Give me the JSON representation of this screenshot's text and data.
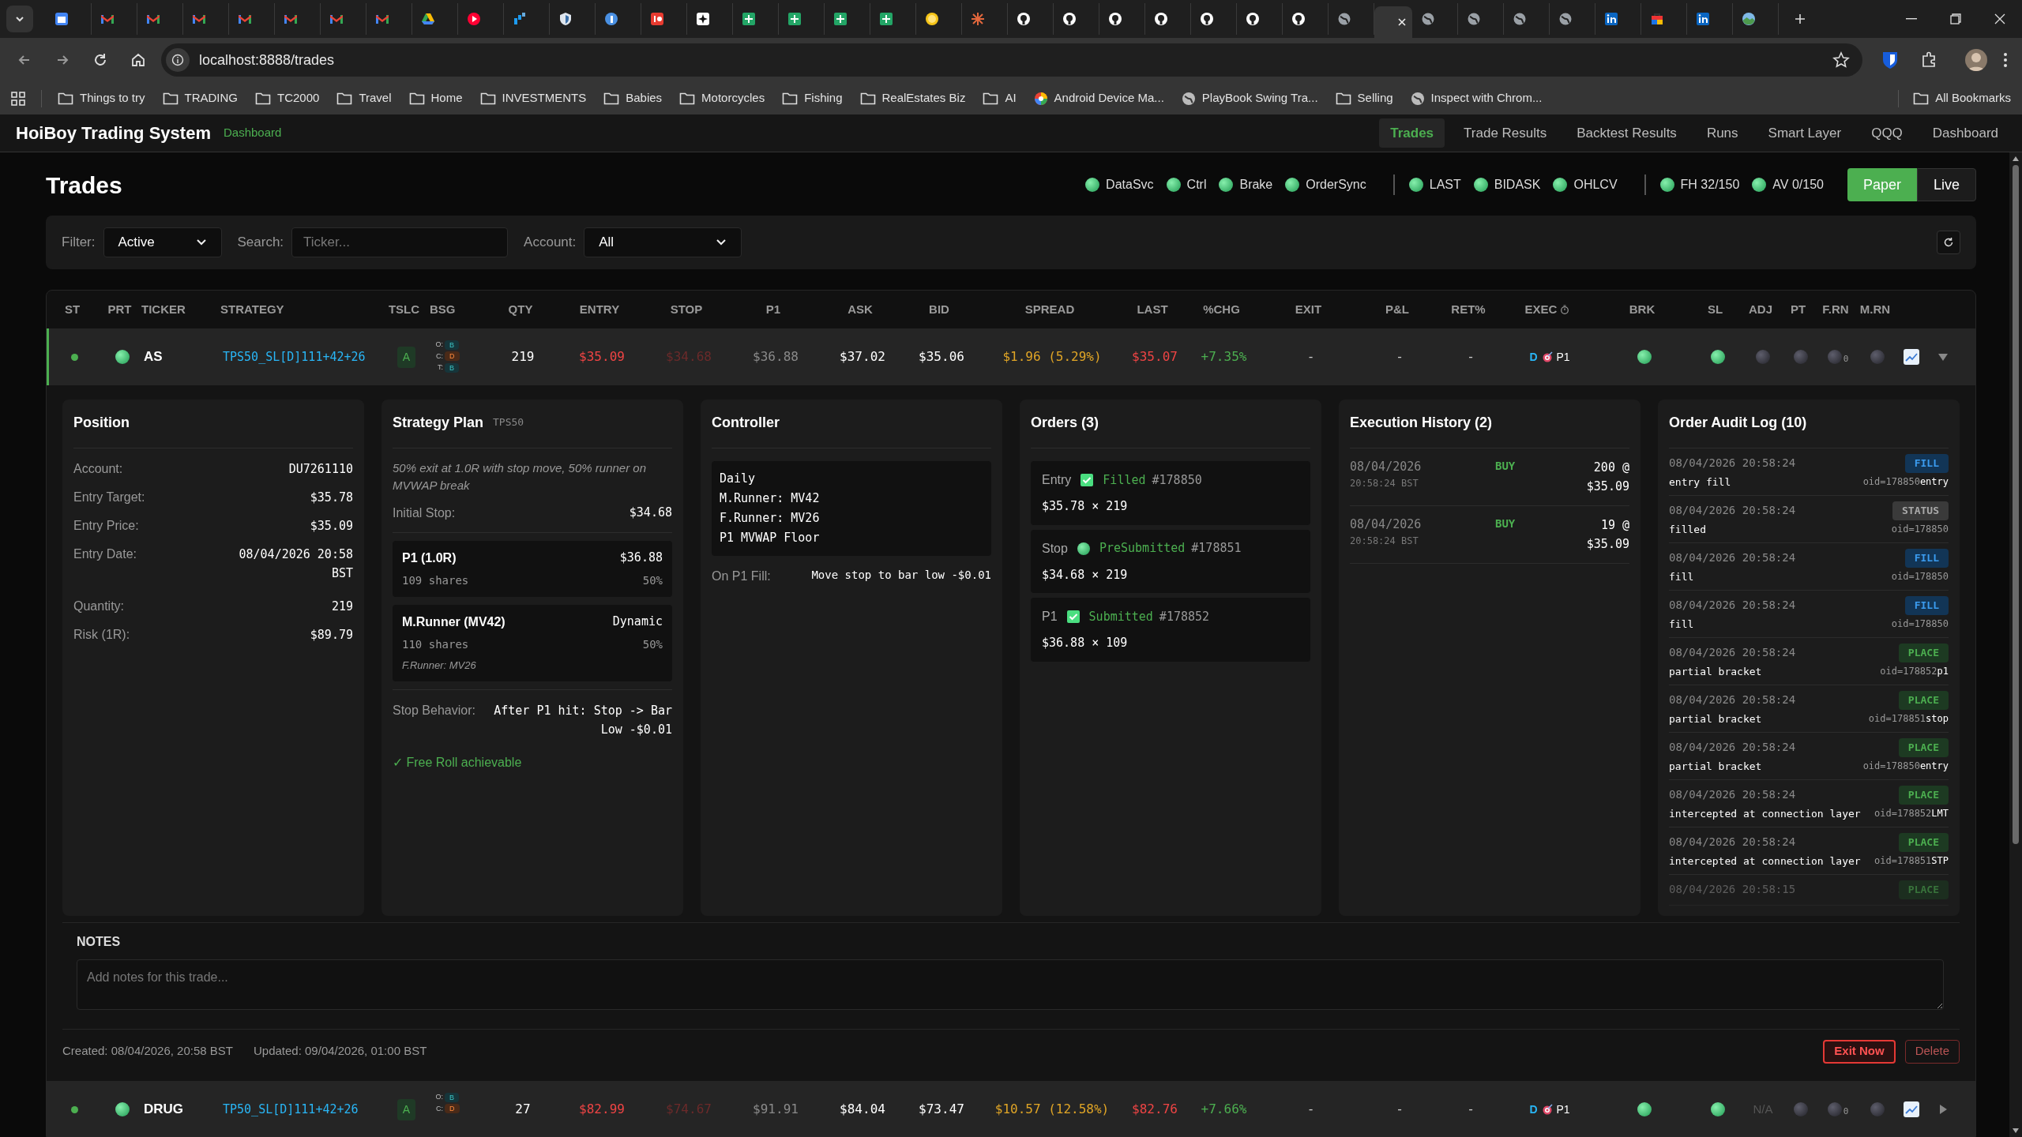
{
  "browser": {
    "tabs": [
      {
        "kind": "calendar",
        "selected": false
      },
      {
        "kind": "mail",
        "selected": false
      },
      {
        "kind": "mail",
        "selected": false
      },
      {
        "kind": "mail",
        "selected": false
      },
      {
        "kind": "mail",
        "selected": false
      },
      {
        "kind": "mail",
        "selected": false
      },
      {
        "kind": "mail",
        "selected": false
      },
      {
        "kind": "mail",
        "selected": false
      },
      {
        "kind": "drive",
        "selected": false
      },
      {
        "kind": "play",
        "selected": false
      },
      {
        "kind": "bars",
        "selected": false
      },
      {
        "kind": "shield",
        "selected": false
      },
      {
        "kind": "bluecircle",
        "selected": false
      },
      {
        "kind": "redsquare",
        "selected": false
      },
      {
        "kind": "sparkle",
        "selected": false
      },
      {
        "kind": "sheets",
        "selected": false
      },
      {
        "kind": "sheets",
        "selected": false
      },
      {
        "kind": "sheets",
        "selected": false
      },
      {
        "kind": "sheets",
        "selected": false
      },
      {
        "kind": "bulb",
        "selected": false
      },
      {
        "kind": "starburst",
        "selected": false
      },
      {
        "kind": "github",
        "selected": false
      },
      {
        "kind": "github",
        "selected": false
      },
      {
        "kind": "github",
        "selected": false
      },
      {
        "kind": "github",
        "selected": false
      },
      {
        "kind": "github",
        "selected": false
      },
      {
        "kind": "github",
        "selected": false
      },
      {
        "kind": "github",
        "selected": false
      },
      {
        "kind": "globe",
        "selected": false
      },
      {
        "kind": "blank",
        "selected": true
      },
      {
        "kind": "globe",
        "selected": false
      },
      {
        "kind": "globe",
        "selected": false
      },
      {
        "kind": "globe",
        "selected": false
      },
      {
        "kind": "globe",
        "selected": false
      },
      {
        "kind": "linkedin",
        "selected": false
      },
      {
        "kind": "bag",
        "selected": false
      },
      {
        "kind": "linkedin",
        "selected": false
      },
      {
        "kind": "landscape",
        "selected": false
      }
    ],
    "url": "localhost:8888/trades",
    "bookmarks": [
      {
        "kind": "folder",
        "label": "Things to try"
      },
      {
        "kind": "folder",
        "label": "TRADING"
      },
      {
        "kind": "folder",
        "label": "TC2000"
      },
      {
        "kind": "folder",
        "label": "Travel"
      },
      {
        "kind": "folder",
        "label": "Home"
      },
      {
        "kind": "folder",
        "label": "INVESTMENTS"
      },
      {
        "kind": "folder",
        "label": "Babies"
      },
      {
        "kind": "folder",
        "label": "Motorcycles"
      },
      {
        "kind": "folder",
        "label": "Fishing"
      },
      {
        "kind": "folder",
        "label": "RealEstates Biz"
      },
      {
        "kind": "folder",
        "label": "AI"
      },
      {
        "kind": "site",
        "label": "Android Device Ma..."
      },
      {
        "kind": "globe",
        "label": "PlayBook Swing Tra..."
      },
      {
        "kind": "folder",
        "label": "Selling"
      },
      {
        "kind": "globe",
        "label": "Inspect with Chrom..."
      }
    ],
    "all_bookmarks": "All Bookmarks"
  },
  "app": {
    "title": "HoiBoy Trading System",
    "subtitle": "Dashboard",
    "nav": [
      {
        "label": "Trades",
        "selected": true
      },
      {
        "label": "Trade Results",
        "selected": false
      },
      {
        "label": "Backtest Results",
        "selected": false
      },
      {
        "label": "Runs",
        "selected": false
      },
      {
        "label": "Smart Layer",
        "selected": false
      },
      {
        "label": "QQQ",
        "selected": false
      },
      {
        "label": "Dashboard",
        "selected": false
      }
    ]
  },
  "page_title": "Trades",
  "indicators": [
    [
      {
        "label": "DataSvc",
        "on": true
      },
      {
        "label": "Ctrl",
        "on": true
      },
      {
        "label": "Brake",
        "on": true
      },
      {
        "label": "OrderSync",
        "on": true
      }
    ],
    [
      {
        "label": "LAST",
        "on": true
      },
      {
        "label": "BIDASK",
        "on": true
      },
      {
        "label": "OHLCV",
        "on": true
      }
    ],
    [
      {
        "label": "FH 32/150",
        "on": true
      },
      {
        "label": "AV 0/150",
        "on": true
      }
    ]
  ],
  "modes": [
    {
      "label": "Paper",
      "selected": true
    },
    {
      "label": "Live",
      "selected": false
    }
  ],
  "filters": {
    "filter_label": "Filter:",
    "filter_value": "Active",
    "search_label": "Search:",
    "search_placeholder": "Ticker...",
    "account_label": "Account:",
    "account_value": "All"
  },
  "table": {
    "columns": [
      "ST",
      "PRT",
      "TICKER",
      "STRATEGY",
      "TSLC",
      "BSG",
      "QTY",
      "ENTRY",
      "STOP",
      "P1",
      "ASK",
      "BID",
      "SPREAD",
      "LAST",
      "%CHG",
      "EXIT",
      "P&L",
      "RET%",
      "EXEC",
      "BRK",
      "SL",
      "ADJ",
      "PT",
      "F.RN",
      "M.RN"
    ],
    "rows": [
      {
        "st": true,
        "prt": true,
        "ticker": "AS",
        "strategy": "TPS50_SL[D]111+42+26",
        "tslc": "A",
        "bsg": [
          {
            "label": "O:",
            "value": "B",
            "kind": "b"
          },
          {
            "label": "C:",
            "value": "D",
            "kind": "d"
          },
          {
            "label": "T:",
            "value": "B",
            "kind": "b"
          }
        ],
        "qty": "219",
        "entry": "$35.09",
        "stop": "$34.68",
        "p1": "$36.88",
        "ask": "$37.02",
        "bid": "$35.06",
        "spread": "$1.96 (5.29%)",
        "last": "$35.07",
        "chg": "+7.35%",
        "exit": "-",
        "pnl": "-",
        "ret": "-",
        "exec_mode": "D",
        "exec_target": "P1",
        "brk": true,
        "sl": true,
        "adj": {
          "kind": "light",
          "on": false
        },
        "pt": false,
        "frn": {
          "on": false,
          "count": "0"
        },
        "mrn": false,
        "expanded": true,
        "detail": {
          "position": {
            "title": "Position",
            "rows": [
              {
                "label": "Account:",
                "value": "DU7261110"
              },
              {
                "label": "Entry Target:",
                "value": "$35.78"
              },
              {
                "label": "Entry Price:",
                "value": "$35.09"
              },
              {
                "label": "Entry Date:",
                "value": "08/04/2026 20:58 BST"
              },
              {
                "label": "Quantity:",
                "value": "219"
              },
              {
                "label": "Risk (1R):",
                "value": "$89.79"
              }
            ]
          },
          "plan": {
            "title": "Strategy Plan",
            "tag": "TPS50",
            "description": "50% exit at 1.0R with stop move, 50% runner on MVWAP break",
            "initial_stop_label": "Initial Stop:",
            "initial_stop": "$34.68",
            "targets": [
              {
                "name": "P1 (1.0R)",
                "value": "$36.88",
                "shares": "109 shares",
                "pct": "50%"
              },
              {
                "name": "M.Runner (MV42)",
                "value": "Dynamic",
                "shares": "110 shares",
                "pct": "50%",
                "note": "F.Runner: MV26"
              }
            ],
            "stop_behavior_label": "Stop Behavior:",
            "stop_behavior": "After P1 hit: Stop -> Bar Low -$0.01",
            "free_roll": "✓ Free Roll achievable"
          },
          "controller": {
            "title": "Controller",
            "lines": [
              "Daily",
              "M.Runner: MV42",
              "F.Runner: MV26",
              "P1 MVWAP Floor"
            ],
            "fill_label": "On P1 Fill:",
            "fill_value": "Move stop to bar low -$0.01"
          },
          "orders": {
            "title": "Orders (3)",
            "items": [
              {
                "name": "Entry",
                "kind": "check",
                "status": "Filled",
                "id": "#178850",
                "price": "$35.78 × 219"
              },
              {
                "name": "Stop",
                "kind": "dot",
                "status": "PreSubmitted",
                "id": "#178851",
                "price": "$34.68 × 219"
              },
              {
                "name": "P1",
                "kind": "check",
                "status": "Submitted",
                "id": "#178852",
                "price": "$36.88 × 109"
              }
            ]
          },
          "executions": {
            "title": "Execution History (2)",
            "items": [
              {
                "date": "08/04/2026",
                "time": "20:58:24 BST",
                "side": "BUY",
                "fill": "200 @ $35.09"
              },
              {
                "date": "08/04/2026",
                "time": "20:58:24 BST",
                "side": "BUY",
                "fill": "19 @ $35.09"
              }
            ]
          },
          "audit": {
            "title": "Order Audit Log (10)",
            "items": [
              {
                "time": "08/04/2026 20:58:24",
                "kind": "fill",
                "badge": "FILL",
                "text": "entry fill",
                "oid": "oid=178850",
                "ref": "entry"
              },
              {
                "time": "08/04/2026 20:58:24",
                "kind": "status",
                "badge": "STATUS",
                "text": "filled",
                "oid": "oid=178850"
              },
              {
                "time": "08/04/2026 20:58:24",
                "kind": "fill",
                "badge": "FILL",
                "text": "fill",
                "oid": "oid=178850"
              },
              {
                "time": "08/04/2026 20:58:24",
                "kind": "fill",
                "badge": "FILL",
                "text": "fill",
                "oid": "oid=178850"
              },
              {
                "time": "08/04/2026 20:58:24",
                "kind": "place",
                "badge": "PLACE",
                "text": "partial bracket",
                "oid": "oid=178852",
                "ref": "p1"
              },
              {
                "time": "08/04/2026 20:58:24",
                "kind": "place",
                "badge": "PLACE",
                "text": "partial bracket",
                "oid": "oid=178851",
                "ref": "stop"
              },
              {
                "time": "08/04/2026 20:58:24",
                "kind": "place",
                "badge": "PLACE",
                "text": "partial bracket",
                "oid": "oid=178850",
                "ref": "entry"
              },
              {
                "time": "08/04/2026 20:58:24",
                "kind": "place",
                "badge": "PLACE",
                "text": "intercepted at connection layer",
                "oid": "oid=178852",
                "ref": "LMT"
              },
              {
                "time": "08/04/2026 20:58:24",
                "kind": "place",
                "badge": "PLACE",
                "text": "intercepted at connection layer",
                "oid": "oid=178851",
                "ref": "STP"
              },
              {
                "time": "08/04/2026 20:58:15",
                "kind": "place",
                "badge": "PLACE"
              }
            ]
          },
          "notes": {
            "title": "NOTES",
            "placeholder": "Add notes for this trade..."
          },
          "created": "Created: 08/04/2026, 20:58 BST",
          "updated": "Updated: 09/04/2026, 01:00 BST",
          "actions": [
            "Exit Now",
            "Delete"
          ]
        }
      },
      {
        "st": true,
        "prt": true,
        "ticker": "DRUG",
        "strategy": "TP50_SL[D]111+42+26",
        "tslc": "A",
        "bsg": [
          {
            "label": "O:",
            "value": "B",
            "kind": "b"
          },
          {
            "label": "C:",
            "value": "D",
            "kind": "d"
          }
        ],
        "qty": "27",
        "entry": "$82.99",
        "stop": "$74.67",
        "p1": "$91.91",
        "ask": "$84.04",
        "bid": "$73.47",
        "spread": "$10.57 (12.58%)",
        "last": "$82.76",
        "chg": "+7.66%",
        "exit": "-",
        "pnl": "-",
        "ret": "-",
        "exec_mode": "D",
        "exec_target": "P1",
        "brk": true,
        "sl": true,
        "adj": {
          "kind": "text",
          "text": "N/A"
        },
        "pt": false,
        "frn": {
          "on": false,
          "count": "0"
        },
        "mrn": false,
        "expanded": false
      }
    ]
  }
}
